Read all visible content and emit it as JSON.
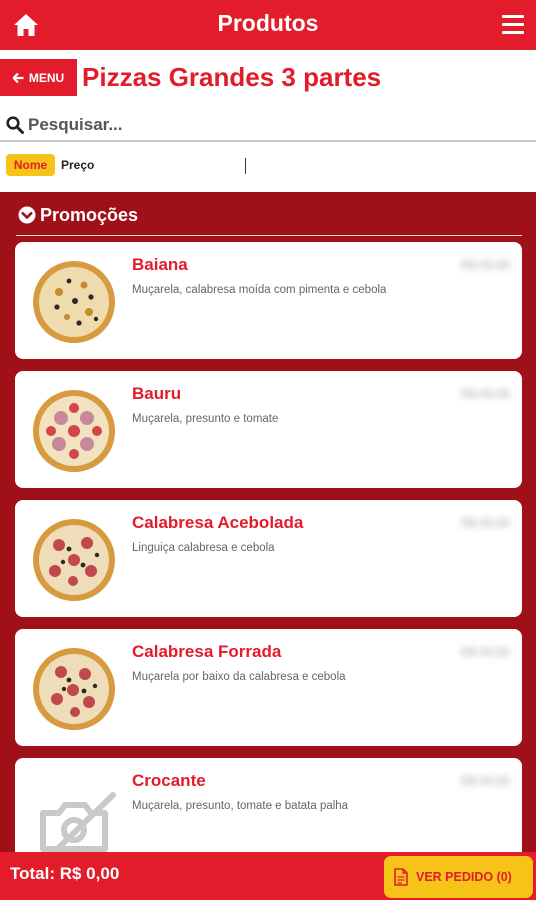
{
  "header": {
    "title": "Produtos",
    "home_icon": "home-icon",
    "menu_icon": "menu-icon"
  },
  "nav": {
    "back_label": "MENU",
    "page_title": "Pizzas Grandes 3 partes"
  },
  "search": {
    "placeholder": "Pesquisar...",
    "value": ""
  },
  "sort": {
    "options": [
      "Nome",
      "Preço"
    ],
    "selected": "Nome"
  },
  "section": {
    "title": "Promoções"
  },
  "products": [
    {
      "name": "Baiana",
      "description": "Muçarela, calabresa moída com pimenta e cebola",
      "image": "pizza-image"
    },
    {
      "name": "Bauru",
      "description": "Muçarela, presunto e tomate",
      "image": "pizza-image"
    },
    {
      "name": "Calabresa Acebolada",
      "description": "Linguiça calabresa e cebola",
      "image": "pizza-image"
    },
    {
      "name": "Calabresa Forrada",
      "description": "Muçarela por baixo da calabresa e cebola",
      "image": "pizza-image"
    },
    {
      "name": "Crocante",
      "description": "Muçarela, presunto, tomate e batata palha",
      "image": "no-image-placeholder"
    }
  ],
  "footer": {
    "total": "Total: R$ 0,00",
    "cart_button": "VER PEDIDO (0)"
  },
  "colors": {
    "primary": "#e21c2a",
    "list_background": "#a01019",
    "accent": "#f6c319"
  }
}
